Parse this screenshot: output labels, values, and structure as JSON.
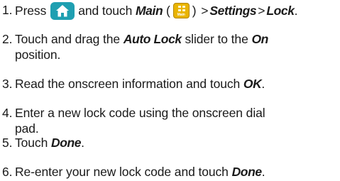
{
  "steps": [
    {
      "number": "1.",
      "text_press": "Press",
      "home_icon": "home-icon",
      "text_touch": "and touch",
      "main_label": "Main",
      "paren_open": "(",
      "main_icon_caption": "Main",
      "paren_close": ")",
      "sep1": ">",
      "settings_label": "Settings",
      "sep2": ">",
      "lock_label": "Lock",
      "period": "."
    },
    {
      "number": "2.",
      "text_a": "Touch and drag the",
      "auto_lock_label": "Auto Lock",
      "text_b": "slider to the",
      "on_label": "On",
      "text_c": "position."
    },
    {
      "number": "3.",
      "text_a": "Read the onscreen information and touch",
      "ok_label": "OK",
      "period": "."
    },
    {
      "number": "4.",
      "line1": "Enter a new lock code using the onscreen dial",
      "line2": "pad."
    },
    {
      "number": "5.",
      "text_a": "Touch",
      "done_label": "Done",
      "period": "."
    },
    {
      "number": "6.",
      "text_a": "Re-enter your new lock code and touch",
      "done_label": "Done",
      "period": "."
    }
  ],
  "colors": {
    "home_key_bg": "#1f9fb1",
    "main_icon_bg": "#e9b400",
    "text": "#1a1a1a"
  }
}
